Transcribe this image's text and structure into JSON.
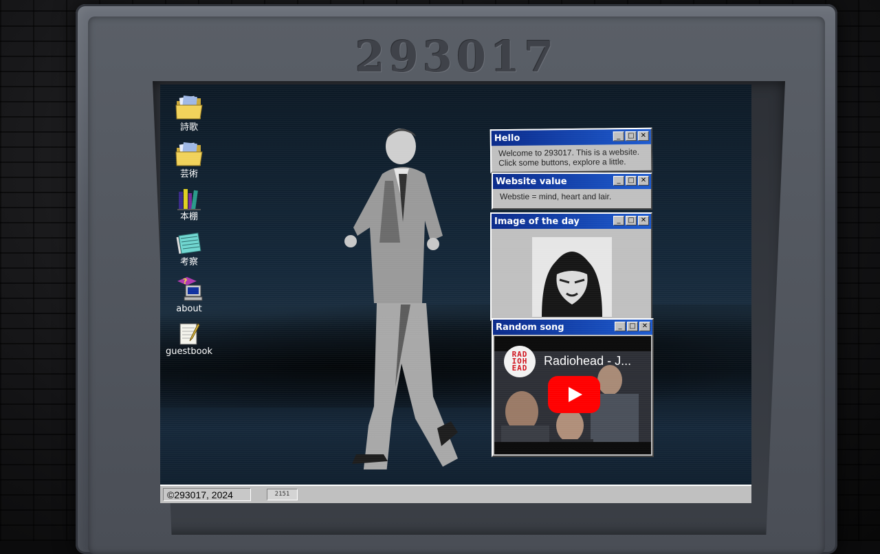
{
  "monitor": {
    "brand": "293017"
  },
  "desktop": {
    "icons": [
      {
        "label": "詩歌",
        "icon": "folder-icon"
      },
      {
        "label": "芸術",
        "icon": "folder-icon"
      },
      {
        "label": "本棚",
        "icon": "books-icon"
      },
      {
        "label": "考察",
        "icon": "notepad-icon"
      },
      {
        "label": "about",
        "icon": "help-computer-icon"
      },
      {
        "label": "guestbook",
        "icon": "write-icon"
      }
    ]
  },
  "windows": {
    "hello": {
      "title": "Hello",
      "line1": "Welcome to 293017. This is a website.",
      "line2": "Click some buttons, explore a little."
    },
    "value": {
      "title": "Website value",
      "text": "Webstie = mind, heart and lair."
    },
    "image": {
      "title": "Image of the day"
    },
    "song": {
      "title": "Random song",
      "video_title": "Radiohead - J...",
      "channel_logo": "RAD IOH EAD"
    },
    "buttons": {
      "minimize": "_",
      "maximize": "□",
      "close": "✕"
    }
  },
  "taskbar": {
    "copyright": "©293017, 2024",
    "counter": "2151"
  },
  "colors": {
    "titlebar": "#0a2a8a",
    "window": "#c0c0c0",
    "youtube_red": "#ff0000"
  }
}
